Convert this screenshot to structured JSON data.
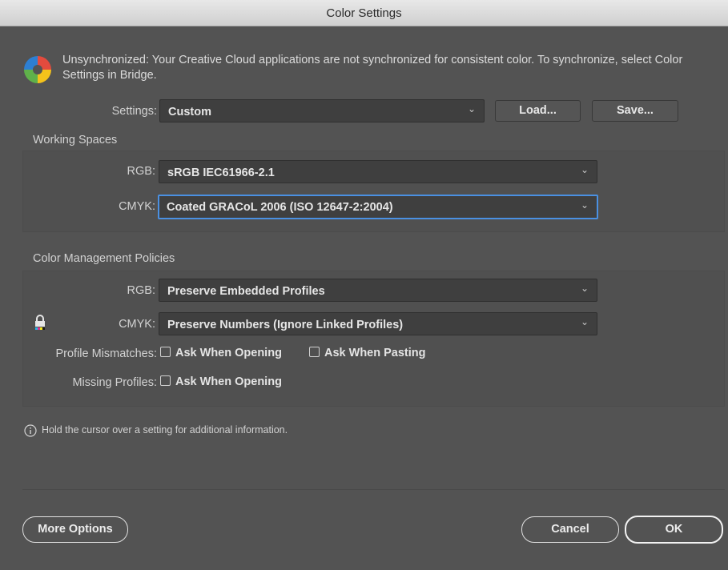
{
  "window": {
    "title": "Color Settings"
  },
  "warning": {
    "icon": "color-sync-icon",
    "text": "Unsynchronized: Your Creative Cloud applications are not synchronized for consistent color. To synchronize, select Color Settings in Bridge."
  },
  "settings": {
    "label": "Settings:",
    "value": "Custom",
    "load_label": "Load...",
    "save_label": "Save..."
  },
  "working_spaces": {
    "title": "Working Spaces",
    "rgb_label": "RGB:",
    "rgb_value": "sRGB IEC61966-2.1",
    "cmyk_label": "CMYK:",
    "cmyk_value": "Coated GRACoL 2006 (ISO 12647-2:2004)"
  },
  "policies": {
    "title": "Color Management Policies",
    "rgb_label": "RGB:",
    "rgb_value": "Preserve Embedded Profiles",
    "cmyk_label": "CMYK:",
    "cmyk_value": "Preserve Numbers (Ignore Linked Profiles)",
    "mismatch_label": "Profile Mismatches:",
    "ask_opening_label": "Ask When Opening",
    "ask_pasting_label": "Ask When Pasting",
    "missing_label": "Missing Profiles:",
    "missing_ask_opening_label": "Ask When Opening",
    "ask_opening_checked": false,
    "ask_pasting_checked": false,
    "missing_ask_opening_checked": false
  },
  "info": {
    "icon": "info-icon",
    "text": "Hold the cursor over a setting for additional information."
  },
  "buttons": {
    "more_options": "More Options",
    "cancel": "Cancel",
    "ok": "OK"
  },
  "colors": {
    "dialog_bg": "#535353",
    "field_bg": "#3f3f3f",
    "focus_ring": "#4a90e2"
  }
}
